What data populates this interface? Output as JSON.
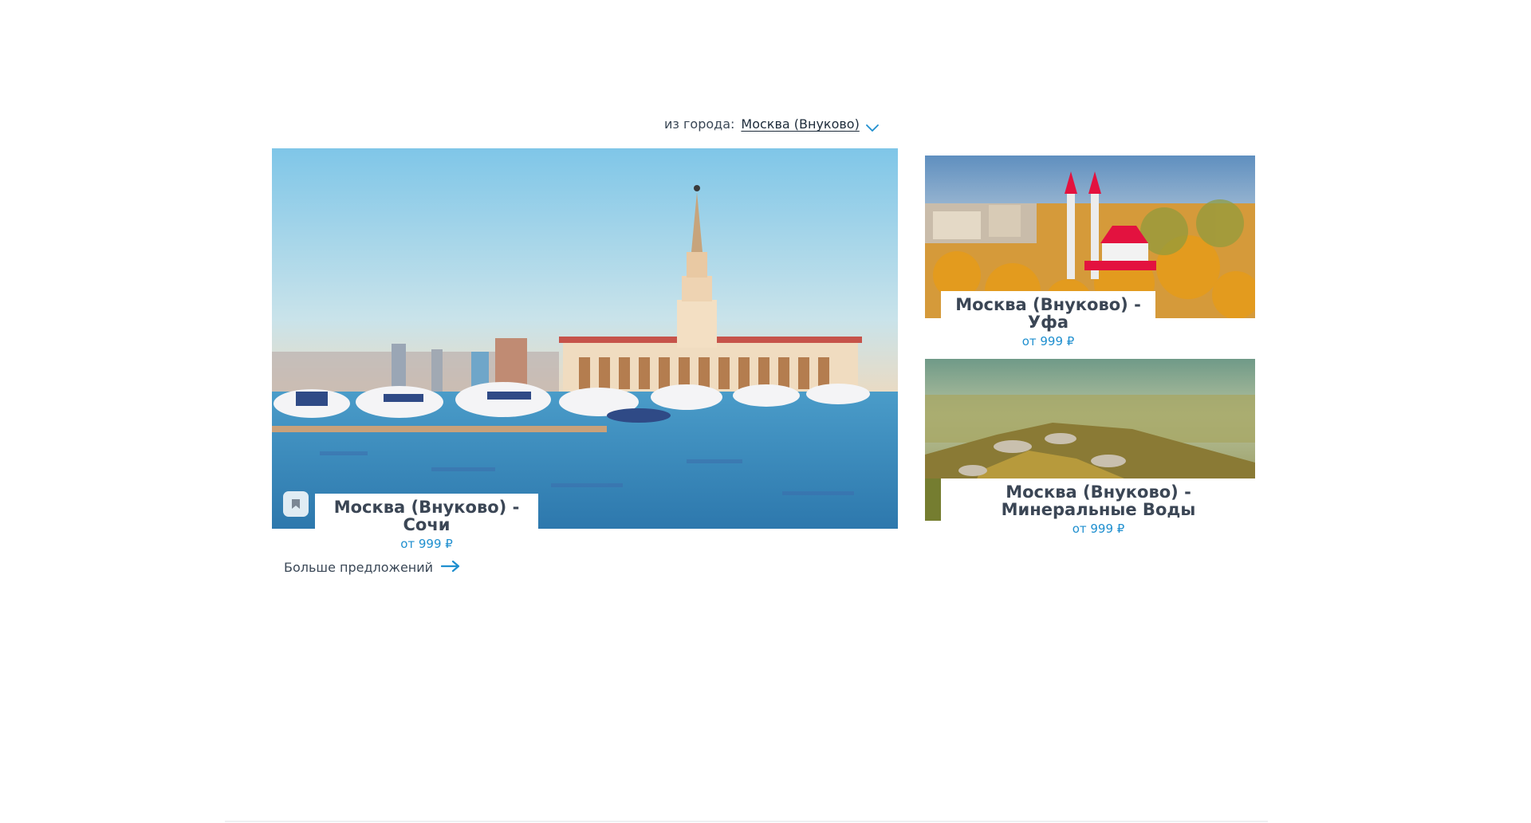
{
  "city_selector": {
    "label": "из города:",
    "value": "Москва (Внуково)"
  },
  "cards": {
    "sochi": {
      "title": "Москва (Внуково) - Сочи",
      "price": "от 999 ₽"
    },
    "ufa": {
      "title": "Москва (Внуково) - Уфа",
      "price": "от 999 ₽"
    },
    "mineralnye_vody": {
      "title": "Москва (Внуково) - Минеральные Воды",
      "price": "от 999 ₽"
    }
  },
  "more_link": {
    "label": "Больше предложений"
  },
  "colors": {
    "accent": "#1f8fcf",
    "text": "#3b4655"
  },
  "icons": {
    "city_chevron": "chevron-down-icon",
    "bookmark": "bookmark-icon",
    "more_arrow": "arrow-right-icon"
  }
}
